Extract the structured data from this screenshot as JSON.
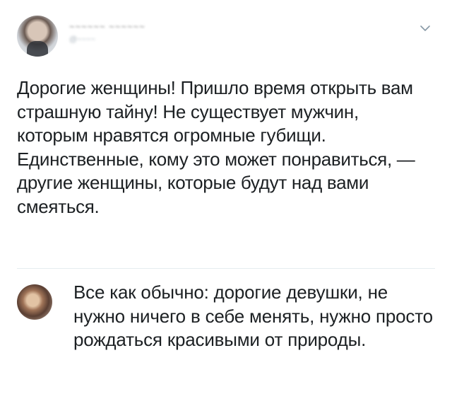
{
  "tweet": {
    "author_name": "~~~~~~ ~~~~~~",
    "author_handle": "@~~~~",
    "text": "Дорогие женщины! Пришло время открыть вам страшную тайну! Не существует мужчин, которым нравятся огромные губищи. Единственные, кому это может понравиться, — другие женщины, которые будут над вами смеяться."
  },
  "reply": {
    "text": "Все как обычно: дорогие девушки, не нужно ничего в себе менять, нужно просто рождаться красивыми от природы."
  },
  "icons": {
    "menu": "chevron-down-icon"
  },
  "colors": {
    "text": "#1c2023",
    "divider": "#e6ecf0",
    "chevron": "#8899a6"
  }
}
